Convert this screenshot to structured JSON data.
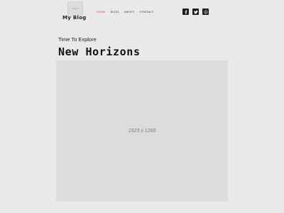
{
  "header": {
    "logo_placeholder": "50x50",
    "brand": "My Blog",
    "nav": [
      {
        "label": "HOME",
        "active": true
      },
      {
        "label": "BLOG",
        "active": false
      },
      {
        "label": "ABOUT",
        "active": false
      },
      {
        "label": "CONTACT",
        "active": false
      }
    ],
    "social_icons": [
      "facebook-icon",
      "twitter-icon",
      "whatsapp-icon"
    ],
    "accent_color": "#e8413b"
  },
  "hero": {
    "subtitle": "Time To Explore",
    "title": "New Horizons",
    "image_placeholder": "1523 x 1260"
  }
}
